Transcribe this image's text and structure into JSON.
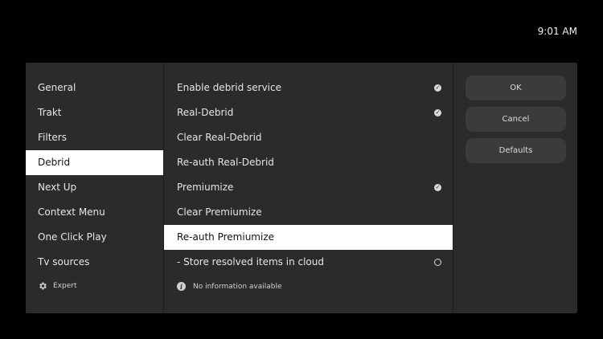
{
  "clock": "9:01 AM",
  "categories": [
    {
      "label": "General"
    },
    {
      "label": "Trakt"
    },
    {
      "label": "Filters"
    },
    {
      "label": "Debrid"
    },
    {
      "label": "Next Up"
    },
    {
      "label": "Context Menu"
    },
    {
      "label": "One Click Play"
    },
    {
      "label": "Tv sources"
    }
  ],
  "selected_category": "Debrid",
  "settings_level": "Expert",
  "settings": [
    {
      "label": "Enable debrid service",
      "control": "check-on"
    },
    {
      "label": "Real-Debrid",
      "control": "check-on"
    },
    {
      "label": "Clear Real-Debrid",
      "control": "none"
    },
    {
      "label": "Re-auth Real-Debrid",
      "control": "none"
    },
    {
      "label": "Premiumize",
      "control": "check-on"
    },
    {
      "label": "Clear Premiumize",
      "control": "none"
    },
    {
      "label": "Re-auth Premiumize",
      "control": "none"
    },
    {
      "label": "- Store resolved items in cloud",
      "control": "radio-off"
    }
  ],
  "focused_setting": "Re-auth Premiumize",
  "info": "No information available",
  "buttons": {
    "ok": "OK",
    "cancel": "Cancel",
    "defaults": "Defaults"
  },
  "colors": {
    "background": "#000000",
    "dialog": "#2b2b2b",
    "highlight": "#ffffff",
    "button": "#3b3b3b"
  }
}
